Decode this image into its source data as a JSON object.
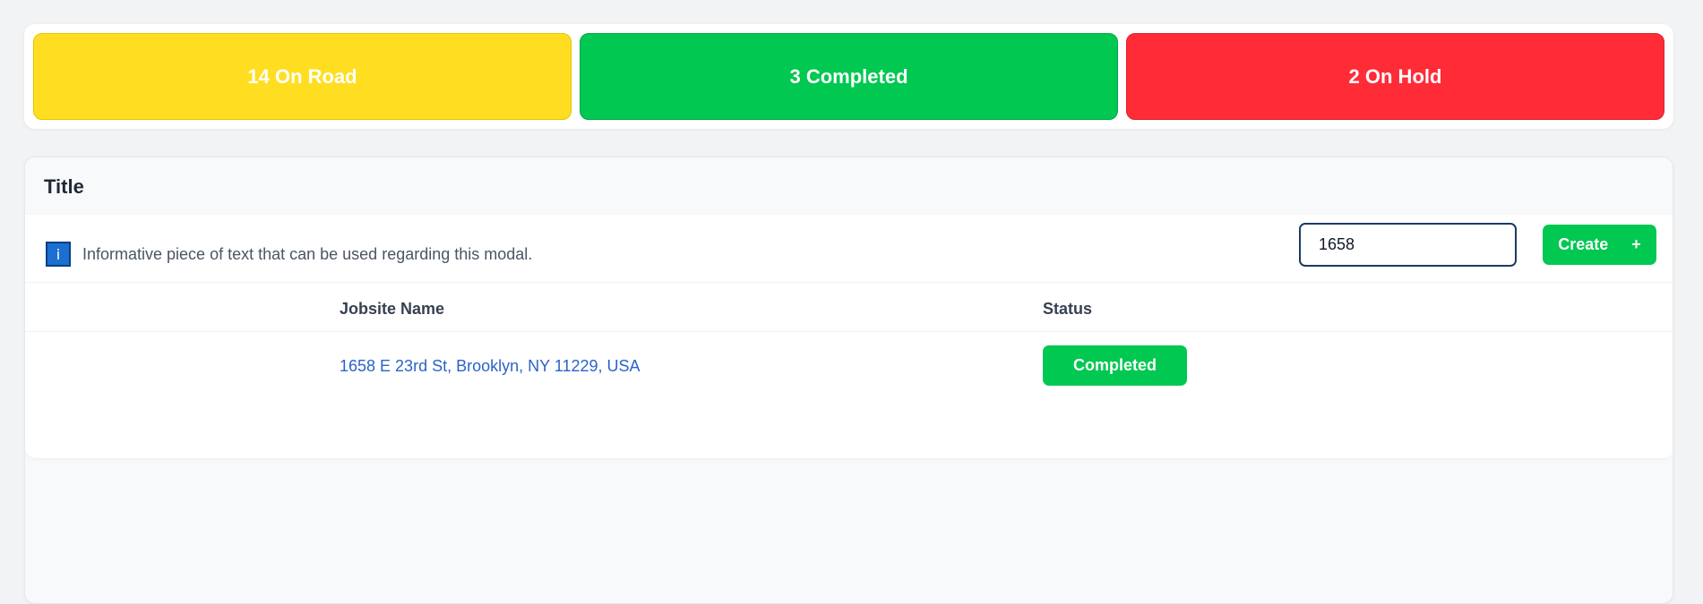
{
  "stats": {
    "on_road": {
      "label": "14 On Road",
      "color": "#ffde21"
    },
    "completed": {
      "label": "3 Completed",
      "color": "#00c851"
    },
    "on_hold": {
      "label": "2 On Hold",
      "color": "#ff2b37"
    }
  },
  "panel": {
    "title": "Title",
    "info": {
      "icon": "info-icon",
      "icon_glyph": "i",
      "text": "Informative piece of text that can be used regarding this modal."
    },
    "search": {
      "value": "1658",
      "placeholder": ""
    },
    "create_button": {
      "label": "Create",
      "icon": "plus-icon",
      "icon_glyph": "+"
    },
    "table": {
      "columns": [
        "Jobsite Name",
        "Status"
      ],
      "rows": [
        {
          "jobsite_name": "1658 E 23rd St, Brooklyn, NY 11229, USA",
          "status": "Completed"
        }
      ]
    }
  }
}
